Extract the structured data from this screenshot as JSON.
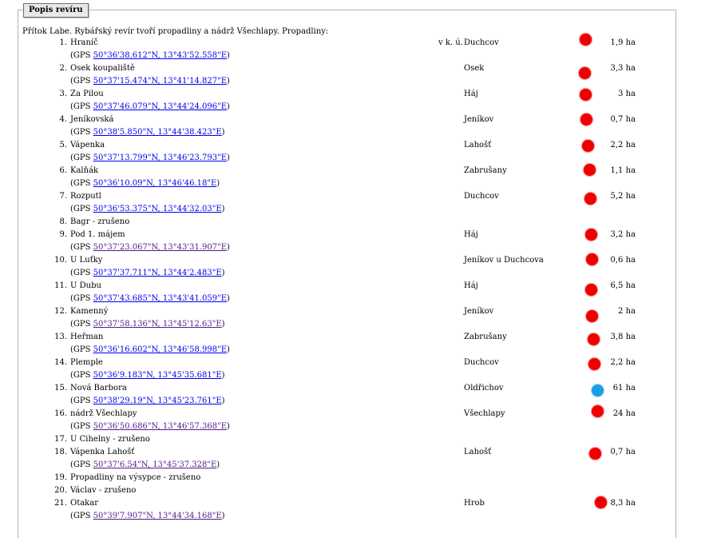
{
  "section": {
    "legend": "Popis revíru",
    "intro": "Přítok Labe. Rybářský revír tvoří propadliny a nádrž Všechlapy. Propadliny:"
  },
  "gps_prefix": "(GPS ",
  "gps_suffix": ")",
  "colors": {
    "red_marker": "#ee0000",
    "blue_marker": "#1a9ee8",
    "link": "#0000ee",
    "visited_link": "#551a8b"
  },
  "items": [
    {
      "num": "1.",
      "name": "Hraníč",
      "prefix": "v k. ú.",
      "place": "Duchcov",
      "marker": "red",
      "area": "1,9 ha",
      "gps": "50°36'38.612\"N, 13°43'52.558\"E"
    },
    {
      "num": "2.",
      "name": "Osek koupaliště",
      "place": "Osek",
      "marker": "red",
      "area": "3,3 ha",
      "gps": "50°37'15.474\"N, 13°41'14.827\"E"
    },
    {
      "num": "3.",
      "name": "Za Pilou",
      "place": "Háj",
      "marker": "red",
      "area": "3 ha",
      "gps": "50°37'46.079\"N, 13°44'24.096\"E"
    },
    {
      "num": "4.",
      "name": "Jeníkovská",
      "place": "Jeníkov",
      "marker": "red",
      "area": "0,7 ha",
      "gps": "50°38'5.850\"N, 13°44'38.423\"E"
    },
    {
      "num": "5.",
      "name": "Vápenka",
      "place": "Lahošť",
      "marker": "red",
      "area": "2,2 ha",
      "gps": "50°37'13.799\"N, 13°46'23.793\"E"
    },
    {
      "num": "6.",
      "name": "Kalňák",
      "place": "Zabrušany",
      "marker": "red",
      "area": "1,1 ha",
      "gps": "50°36'10.09\"N, 13°46'46.18\"E"
    },
    {
      "num": "7.",
      "name": "Rozputl",
      "place": "Duchcov",
      "marker": "red",
      "area": "5,2 ha",
      "gps": "50°36'53.375\"N, 13°44'32.03\"E"
    },
    {
      "num": "8.",
      "name": "Bagr - zrušeno"
    },
    {
      "num": "9.",
      "name": "Pod 1. májem",
      "place": "Háj",
      "marker": "red",
      "area": "3,2 ha",
      "gps": "50°37'23.067\"N, 13°43'31.907\"E"
    },
    {
      "num": "10.",
      "name": "U Luťky",
      "place": "Jeníkov u Duchcova",
      "marker": "red",
      "area": "0,6 ha",
      "gps": "50°37'37.711\"N, 13°44'2.483\"E"
    },
    {
      "num": "11.",
      "name": "U Dubu",
      "place": "Háj",
      "marker": "red",
      "area": "6,5 ha",
      "gps": "50°37'43.685\"N, 13°43'41.059\"E"
    },
    {
      "num": "12.",
      "name": "Kamenný",
      "place": "Jeníkov",
      "marker": "red",
      "area": "2 ha",
      "gps": "50°37'58.136\"N, 13°45'12.63\"E"
    },
    {
      "num": "13.",
      "name": "Heřman",
      "place": "Zabrušany",
      "marker": "red",
      "area": "3,8 ha",
      "gps": "50°36'16.602\"N, 13°46'58.998\"E"
    },
    {
      "num": "14.",
      "name": "Plemple",
      "place": "Duchcov",
      "marker": "red",
      "area": "2,2 ha",
      "gps": "50°36'9.183\"N, 13°45'35.681\"E"
    },
    {
      "num": "15.",
      "name": "Nová Barbora",
      "place": "Oldřichov",
      "marker": "blue",
      "area": "61 ha",
      "gps": "50°38'29.19\"N, 13°45'23.761\"E"
    },
    {
      "num": "16.",
      "name": "nádrž Všechlapy",
      "place": "Všechlapy",
      "marker": "red",
      "area": "24 ha",
      "gps": "50°36'50.686\"N, 13°46'57.368\"E"
    },
    {
      "num": "17.",
      "name": "U Cihelny - zrušeno"
    },
    {
      "num": "18.",
      "name": "Vápenka Lahošť",
      "place": "Lahošť",
      "marker": "red",
      "area": "0,7 ha",
      "gps": "50°37'6.54\"N, 13°45'37.328\"E"
    },
    {
      "num": "19.",
      "name": "Propadliny na výsypce - zrušeno"
    },
    {
      "num": "20.",
      "name": "Václav - zrušeno"
    },
    {
      "num": "21.",
      "name": "Otakar",
      "place": "Hrob",
      "marker": "red",
      "area": "8,3 ha",
      "gps": "50°39'7.907\"N, 13°44'34.168\"E"
    }
  ]
}
